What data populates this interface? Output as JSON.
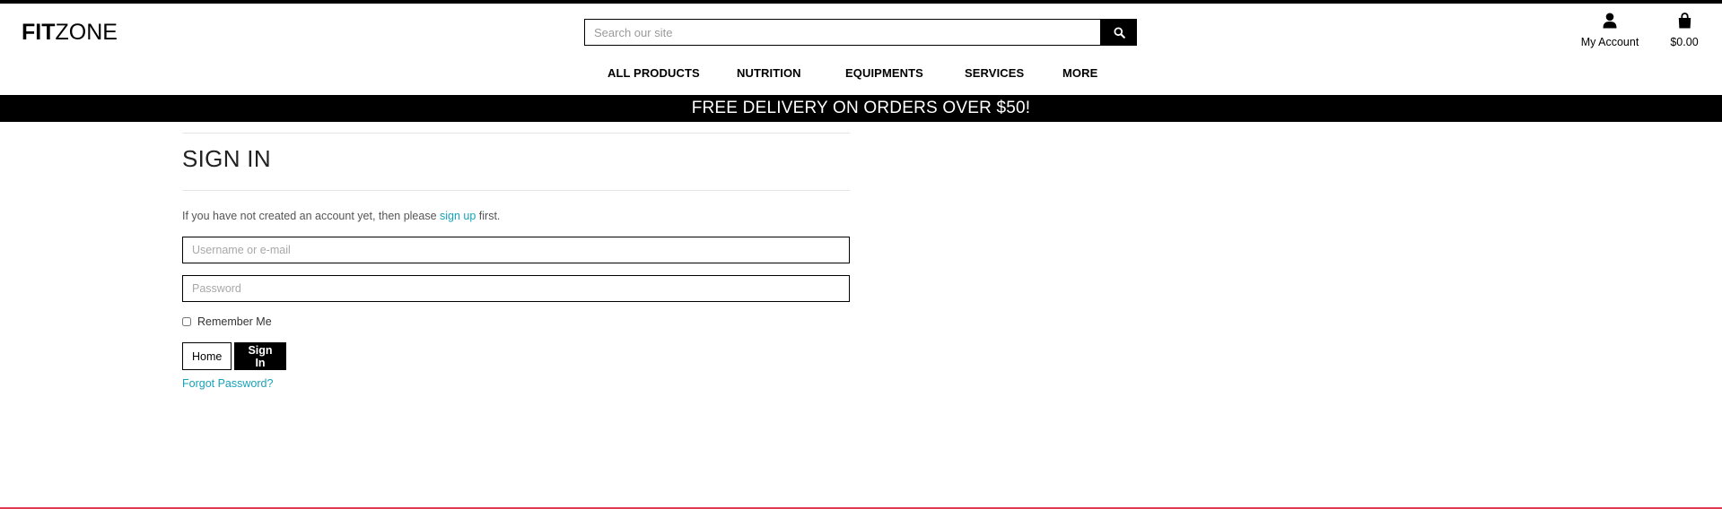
{
  "header": {
    "logo_bold": "FIT",
    "logo_regular": "ZONE",
    "search_placeholder": "Search our site",
    "account_label": "My Account",
    "bag_total": "$0.00"
  },
  "nav": {
    "items": [
      "ALL PRODUCTS",
      "NUTRITION",
      "EQUIPMENTS",
      "SERVICES",
      "MORE"
    ]
  },
  "banner": {
    "text": "FREE DELIVERY ON ORDERS OVER $50!"
  },
  "signin": {
    "title": "SIGN IN",
    "intro_before": "If you have not created an account yet, then please ",
    "intro_link": "sign up",
    "intro_after": " first.",
    "username_placeholder": "Username or e-mail",
    "password_placeholder": "Password",
    "remember_label": "Remember Me",
    "home_button": "Home",
    "signin_button": "Sign In",
    "forgot_link": "Forgot Password?"
  },
  "colors": {
    "brand": "#000000",
    "link": "#17a2b8",
    "bottom_accent": "#e03a4e"
  },
  "icons": {
    "search": "search-icon",
    "account": "user-icon",
    "bag": "shopping-bag-icon"
  }
}
